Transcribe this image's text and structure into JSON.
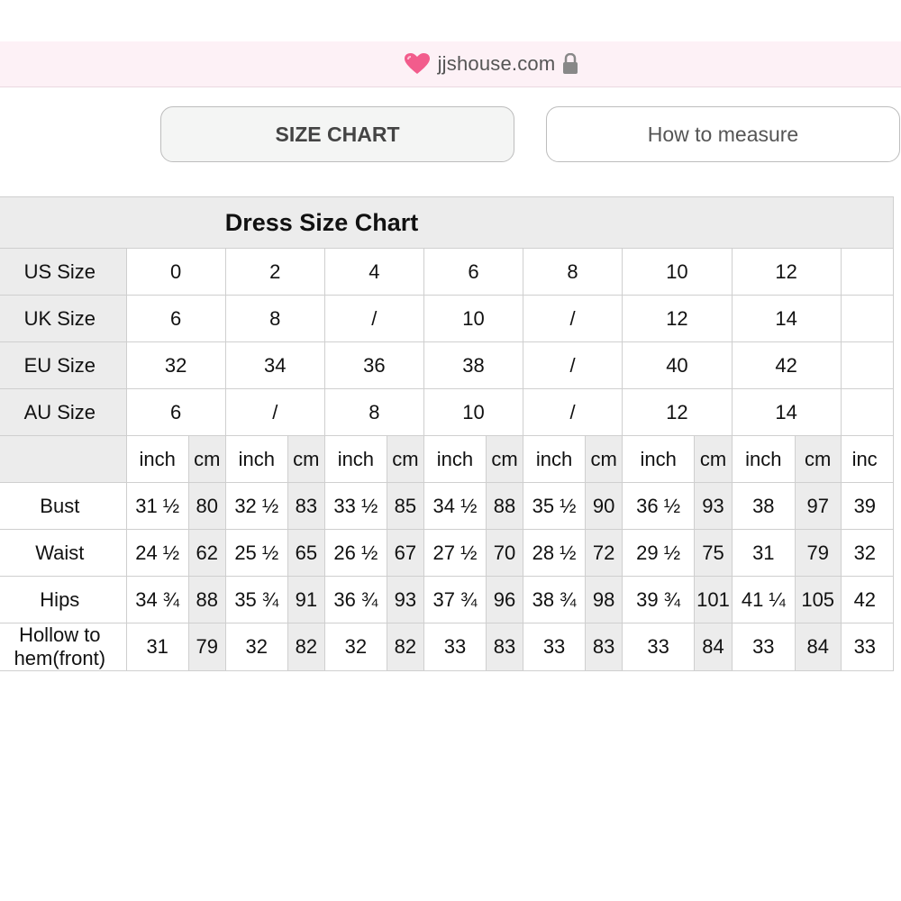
{
  "browser": {
    "url": "jjshouse.com"
  },
  "tabs": {
    "size_chart": "SIZE CHART",
    "how_to_measure": "How to measure"
  },
  "table": {
    "title": "Dress Size Chart",
    "size_rows": [
      {
        "label": "US Size",
        "values": [
          "0",
          "2",
          "4",
          "6",
          "8",
          "10",
          "12"
        ]
      },
      {
        "label": "UK Size",
        "values": [
          "6",
          "8",
          "/",
          "10",
          "/",
          "12",
          "14"
        ]
      },
      {
        "label": "EU Size",
        "values": [
          "32",
          "34",
          "36",
          "38",
          "/",
          "40",
          "42"
        ]
      },
      {
        "label": "AU Size",
        "values": [
          "6",
          "/",
          "8",
          "10",
          "/",
          "12",
          "14"
        ]
      }
    ],
    "unit_inch": "inch",
    "unit_cm": "cm",
    "unit_partial": "inc",
    "measure_rows": [
      {
        "label": "Bust",
        "values": [
          "31 ½",
          "80",
          "32 ½",
          "83",
          "33 ½",
          "85",
          "34 ½",
          "88",
          "35 ½",
          "90",
          "36 ½",
          "93",
          "38",
          "97"
        ],
        "partial": "39"
      },
      {
        "label": "Waist",
        "values": [
          "24 ½",
          "62",
          "25 ½",
          "65",
          "26 ½",
          "67",
          "27 ½",
          "70",
          "28 ½",
          "72",
          "29 ½",
          "75",
          "31",
          "79"
        ],
        "partial": "32"
      },
      {
        "label": "Hips",
        "values": [
          "34 ¾",
          "88",
          "35 ¾",
          "91",
          "36 ¾",
          "93",
          "37 ¾",
          "96",
          "38 ¾",
          "98",
          "39 ¾",
          "101",
          "41 ¼",
          "105"
        ],
        "partial": "42"
      },
      {
        "label": "Hollow to hem(front)",
        "values": [
          "31",
          "79",
          "32",
          "82",
          "32",
          "82",
          "33",
          "83",
          "33",
          "83",
          "33",
          "84",
          "33",
          "84"
        ],
        "partial": "33"
      }
    ]
  },
  "colors": {
    "header_bg": "#ececec",
    "urlbar_bg": "#fdf1f6",
    "heart": "#f25c8c"
  }
}
